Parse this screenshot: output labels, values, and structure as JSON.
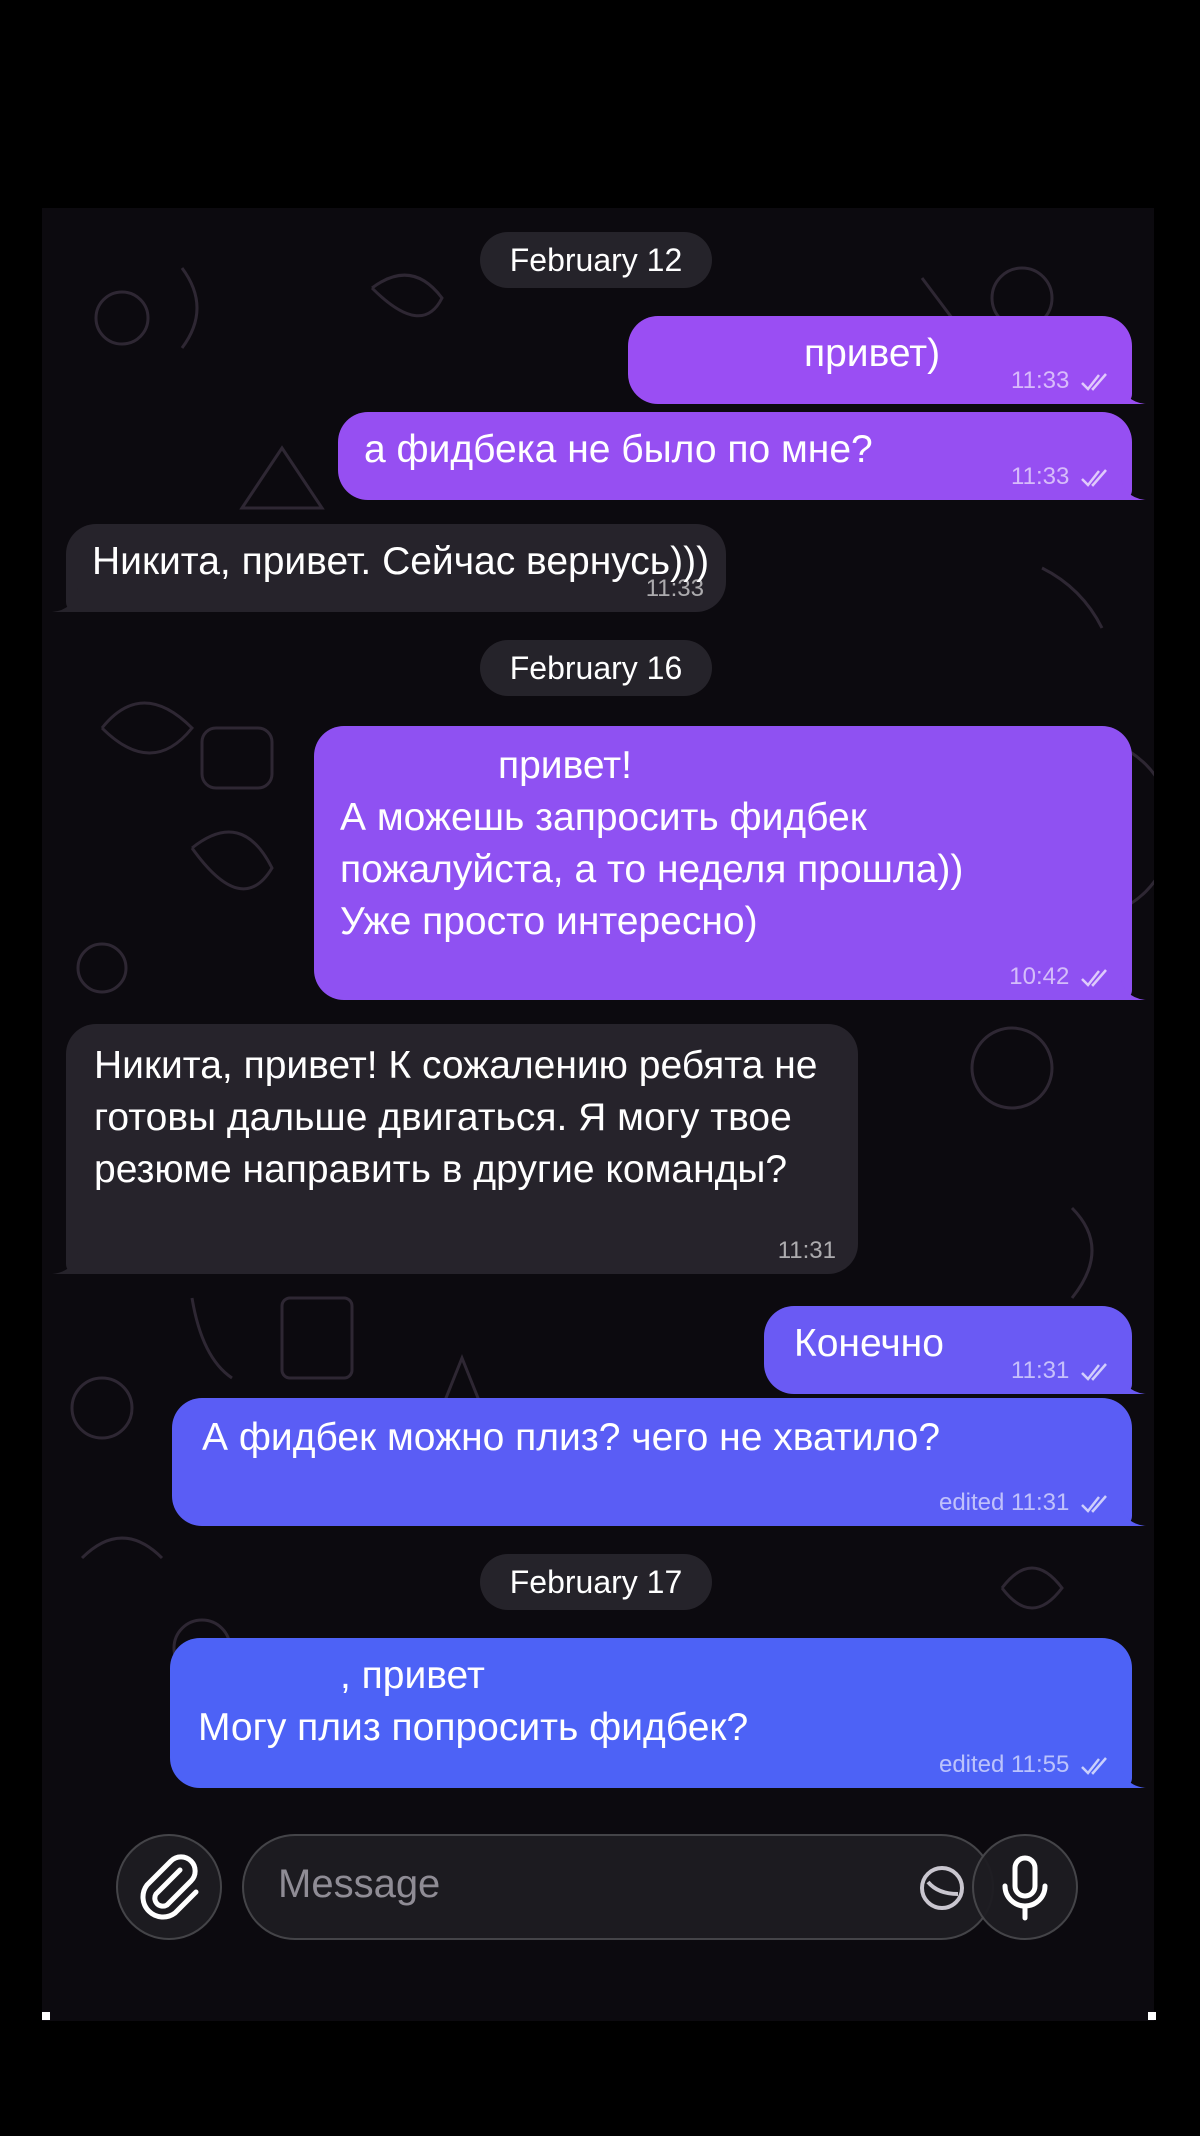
{
  "chat": {
    "dates": [
      "February 12",
      "February 16",
      "February 17"
    ],
    "messages": [
      {
        "dir": "out",
        "text": "привет)",
        "time": "11:33",
        "edited": false
      },
      {
        "dir": "out",
        "text": "а фидбека не было по мне?",
        "time": "11:33",
        "edited": false
      },
      {
        "dir": "in",
        "text": "Никита, привет. Сейчас вернусь)))",
        "time": "11:33",
        "edited": false
      },
      {
        "dir": "out",
        "lines": [
          "привет!",
          "А можешь запросить фидбек",
          "пожалуйста, а то неделя прошла))",
          "Уже просто интересно)"
        ],
        "time": "10:42",
        "edited": false
      },
      {
        "dir": "in",
        "lines": [
          "Никита, привет! К сожалению ребята не",
          "готовы дальше двигаться. Я могу твое",
          "резюме направить в другие команды?"
        ],
        "time": "11:31",
        "edited": false
      },
      {
        "dir": "out",
        "text": "Конечно",
        "time": "11:31",
        "edited": false
      },
      {
        "dir": "out",
        "text": "А фидбек можно плиз? чего не хватило?",
        "time": "edited 11:31",
        "edited": true
      },
      {
        "dir": "out",
        "lines": [
          ", привет",
          "Могу плиз попросить фидбек?"
        ],
        "time": "edited 11:55",
        "edited": true
      }
    ]
  },
  "composer": {
    "placeholder": "Message",
    "attach_icon": "paperclip-icon",
    "sticker_icon": "sticker-icon",
    "mic_icon": "microphone-icon"
  },
  "colors": {
    "bubble_out_top": "#9b4cf2",
    "bubble_out_bottom": "#4b62f5",
    "bubble_in": "#26232b",
    "background": "#0c0a0f"
  }
}
